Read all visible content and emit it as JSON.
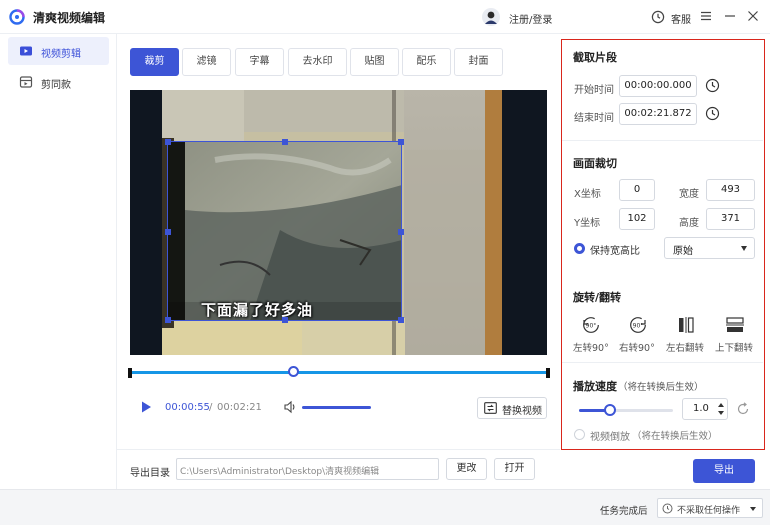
{
  "app": {
    "title": "清爽视频编辑",
    "login": "注册/登录",
    "service": "客服"
  },
  "sidebar": {
    "items": [
      {
        "label": "视频剪辑",
        "active": true
      },
      {
        "label": "剪同款",
        "active": false
      }
    ]
  },
  "tools": {
    "tabs": [
      {
        "label": "裁剪",
        "active": true
      },
      {
        "label": "滤镜",
        "active": false
      },
      {
        "label": "字幕",
        "active": false
      },
      {
        "label": "去水印",
        "active": false
      },
      {
        "label": "贴图",
        "active": false
      },
      {
        "label": "配乐",
        "active": false
      },
      {
        "label": "封面",
        "active": false
      }
    ]
  },
  "preview": {
    "subtitle": "下面漏了好多油",
    "playhead_fraction": 0.39
  },
  "player": {
    "current_time": "00:00:55",
    "separator": "/",
    "total_time": "00:02:21",
    "replace_label": "替换视频",
    "volume_fraction": 1.0
  },
  "export": {
    "label": "导出目录",
    "path": "C:\\Users\\Administrator\\Desktop\\清爽视频编辑",
    "change_label": "更改",
    "open_label": "打开",
    "export_label": "导出"
  },
  "panel": {
    "clip": {
      "title": "截取片段",
      "start_label": "开始时间",
      "start_value": "00:00:00.000",
      "end_label": "结束时间",
      "end_value": "00:02:21.872"
    },
    "crop": {
      "title": "画面裁切",
      "x_label": "X坐标",
      "x_value": "0",
      "width_label": "宽度",
      "width_value": "493",
      "y_label": "Y坐标",
      "y_value": "102",
      "height_label": "高度",
      "height_value": "371",
      "keep_ratio_label": "保持宽高比",
      "keep_ratio_checked": true,
      "ratio_value": "原始"
    },
    "rotate": {
      "title": "旋转/翻转",
      "options": [
        {
          "label": "左转90°",
          "icon": "rotate-left-icon",
          "glyph": "90°"
        },
        {
          "label": "右转90°",
          "icon": "rotate-right-icon",
          "glyph": "90°"
        },
        {
          "label": "左右翻转",
          "icon": "flip-horizontal-icon"
        },
        {
          "label": "上下翻转",
          "icon": "flip-vertical-icon"
        }
      ]
    },
    "speed": {
      "title": "播放速度",
      "note": "（将在转换后生效）",
      "value": "1.0",
      "slider_fraction": 0.33,
      "reverse_label": "视频倒放",
      "reverse_note": "（将在转换后生效）",
      "reverse_checked": false
    }
  },
  "status": {
    "after_label": "任务完成后",
    "after_value": "不采取任何操作"
  },
  "colors": {
    "accent": "#3d55d6",
    "highlight_border": "#d9261c",
    "timeline": "#1596e6"
  }
}
